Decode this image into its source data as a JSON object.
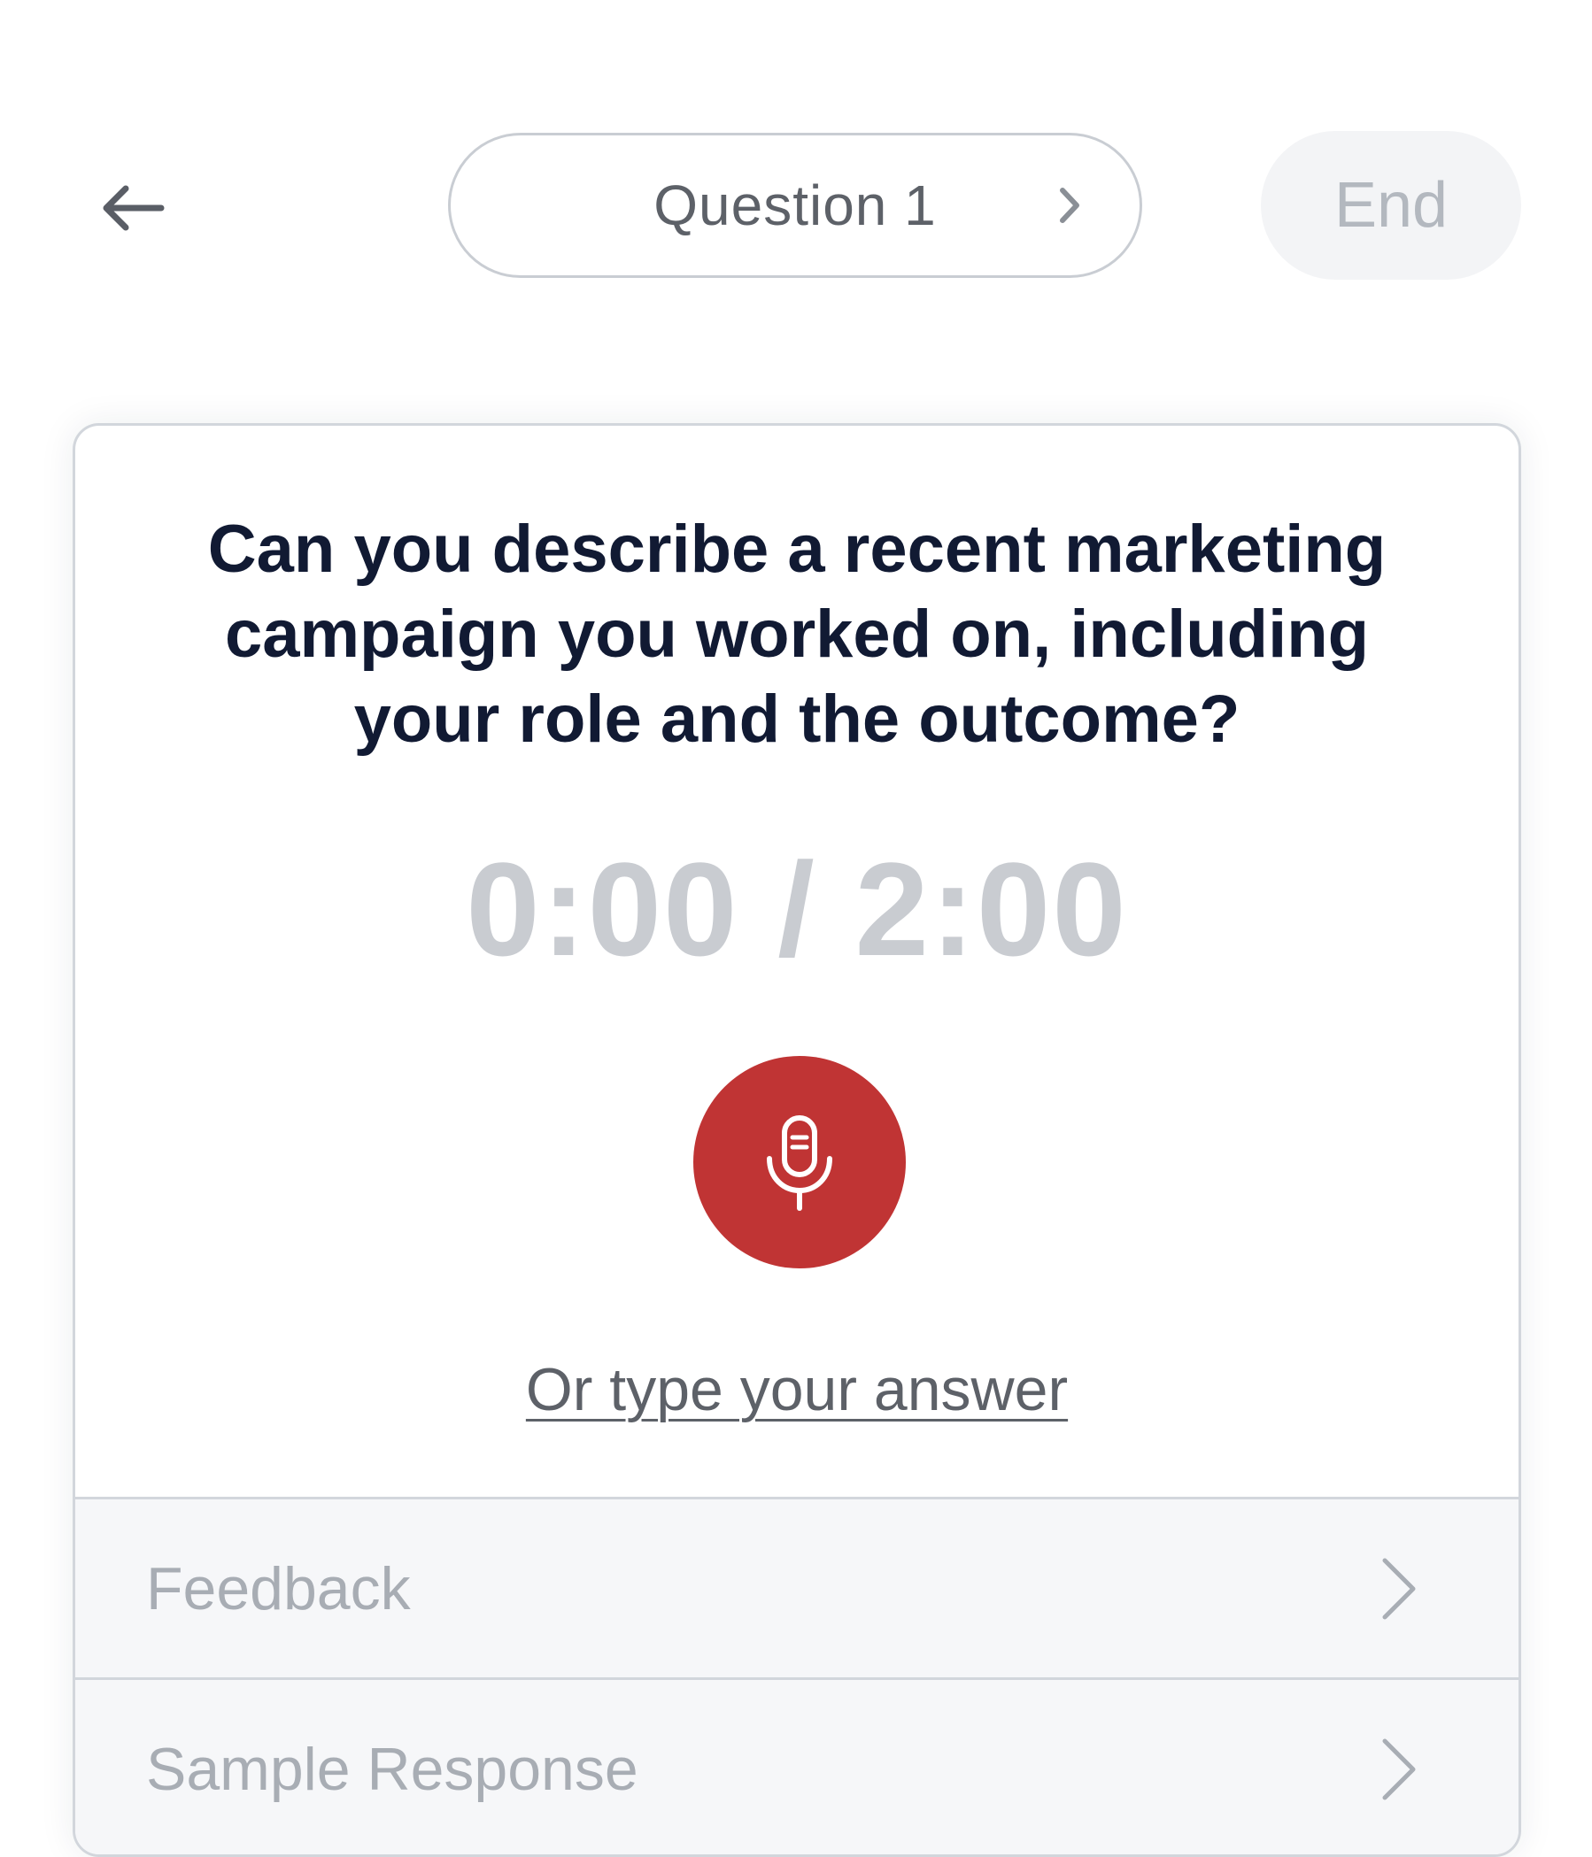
{
  "header": {
    "back_icon": "arrow-left-icon",
    "question_label": "Question 1",
    "question_chevron_icon": "chevron-right-icon",
    "end_label": "End"
  },
  "question": {
    "text": "Can you describe a recent marketing campaign you worked on, including your role and the outcome?"
  },
  "timer": {
    "elapsed": "0:00",
    "separator": "/",
    "limit": "2:00",
    "display": "0:00 / 2:00"
  },
  "mic": {
    "icon": "microphone-icon",
    "color": "#c03434"
  },
  "type_answer": {
    "label": "Or type your answer"
  },
  "sections": [
    {
      "label": "Feedback",
      "icon": "chevron-right-icon"
    },
    {
      "label": "Sample Response",
      "icon": "chevron-right-icon"
    }
  ]
}
